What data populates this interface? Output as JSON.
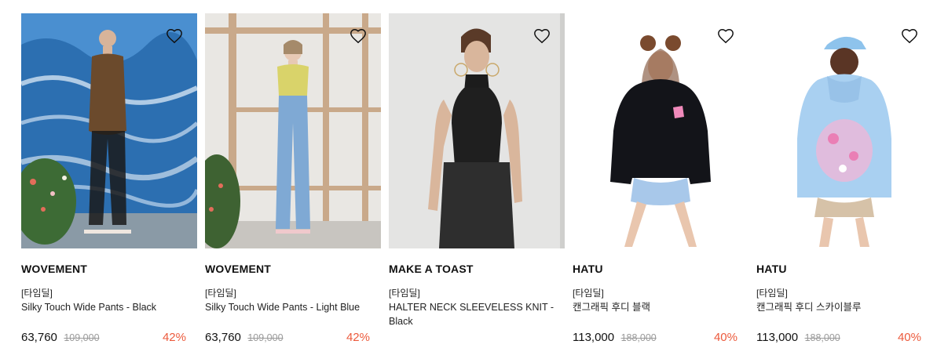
{
  "products": [
    {
      "brand": "WOVEMENT",
      "tag": "[타임딜]",
      "name": "Silky Touch Wide Pants - Black",
      "price": "63,760",
      "original_price": "109,000",
      "discount": "42%",
      "image": "model in floral dress with sheer black wide pants in front of ocean wave mural"
    },
    {
      "brand": "WOVEMENT",
      "tag": "[타임딜]",
      "name": "Silky Touch Wide Pants - Light Blue",
      "price": "63,760",
      "original_price": "109,000",
      "discount": "42%",
      "image": "model in yellow top and light blue wide pants in wooden studio"
    },
    {
      "brand": "MAKE A TOAST",
      "tag": "[타임딜]",
      "name": "HALTER NECK SLEEVELESS KNIT - Black",
      "price": "",
      "original_price": "",
      "discount": "",
      "image": "model in black halter neck sleeveless knit"
    },
    {
      "brand": "HATU",
      "tag": "[타임딜]",
      "name": "캔그래픽 후디 블랙",
      "price": "113,000",
      "original_price": "188,000",
      "discount": "40%",
      "image": "model in black hoodie with pink graphic and light blue shorts"
    },
    {
      "brand": "HATU",
      "tag": "[타임딜]",
      "name": "캔그래픽 후디 스카이블루",
      "price": "113,000",
      "original_price": "188,000",
      "discount": "40%",
      "image": "model in sky blue hoodie and cap seen from back with pink graphic"
    }
  ],
  "colors": {
    "discount": "#ec5a3c",
    "original_price": "#9a9a9a",
    "text": "#111111"
  },
  "icons": {
    "wishlist": "heart-outline-icon"
  }
}
